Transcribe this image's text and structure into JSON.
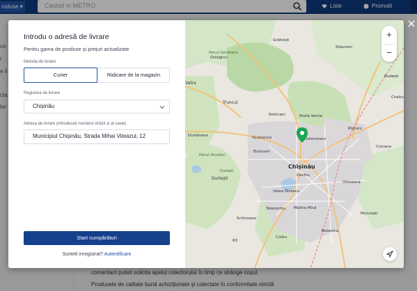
{
  "header": {
    "products_label": "roduse",
    "search_placeholder": "Cautati in METRO",
    "lists_label": "Liste",
    "promotions_label": "Promotii"
  },
  "background": {
    "left_fragments": [
      "co",
      "r",
      "e li",
      "cta",
      "lor"
    ],
    "text_line_1": "comentarii puteti solicita apelul colectorului în timp ce strânge coșul.",
    "text_line_2": "Produsele de calitate bună achiziționate și colectate în conformitate strictă"
  },
  "modal": {
    "title": "Introdu o adresă de livrare",
    "subtitle": "Pentru gama de produse și prețuri actualizate",
    "delivery_method_label": "Metoda de livrare",
    "courier_label": "Curier",
    "pickup_label": "Ridicare de la magazin",
    "region_label": "Regiunea de livrare",
    "region_value": "Chișinău",
    "address_label": "Adresa de livrare (introduceți numărul străzii și al casei)",
    "address_value": "Municipiul Chișinău, Strada Mihai Viteazul, 12",
    "start_button": "Start cumpărături",
    "registered_prompt": "Sunteti inregistrat?",
    "login_link": "Autentificare"
  },
  "map": {
    "labels": {
      "gratiesti": "Grătiești",
      "stauceni": "Stăuceni",
      "budesti": "Budești",
      "cheltu": "Cheltu",
      "vatra": "Vatra",
      "parcul_dendrariu": "Parcul Dendrariu",
      "ghidighici": "Ghidighici",
      "truncul": "Truncul",
      "petricani": "Petricani",
      "posta_veche": "Posta Veche",
      "visterniceni": "Visterniceni",
      "rascani": "Rîșcani",
      "ciocana": "Ciocana",
      "durleshti_big": "Durlești",
      "sculeanca": "Sculeanca",
      "buiucani": "Buiucani",
      "dumbrava": "Dumbrava",
      "parcul_alunelul": "Parcul Alunelul",
      "durlesti": "Durlești",
      "chisinau": "Chișinău",
      "centru": "Centru",
      "valea_dicescu": "Valea Dicescu",
      "telecentru": "Telecentru",
      "malina_mica": "Malina Mică",
      "munceesti": "Muncești",
      "schinoasa": "Schinoasa",
      "botanica": "Botanica",
      "codru": "Codru",
      "otovasca": "Otovasca",
      "r3": "R3"
    },
    "zoom_in": "+",
    "zoom_out": "−"
  }
}
